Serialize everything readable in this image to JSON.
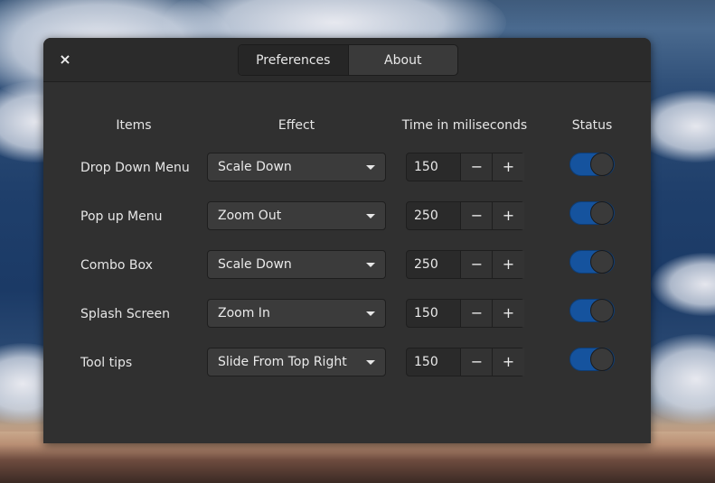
{
  "tabs": [
    {
      "label": "Preferences",
      "active": true
    },
    {
      "label": "About",
      "active": false
    }
  ],
  "close_glyph": "×",
  "columns": {
    "items": "Items",
    "effect": "Effect",
    "time": "Time in miliseconds",
    "status": "Status"
  },
  "rows": [
    {
      "label": "Drop Down Menu",
      "effect": "Scale Down",
      "time": "150",
      "status_on": true
    },
    {
      "label": "Pop up Menu",
      "effect": "Zoom Out",
      "time": "250",
      "status_on": true
    },
    {
      "label": "Combo Box",
      "effect": "Scale Down",
      "time": "250",
      "status_on": true
    },
    {
      "label": "Splash Screen",
      "effect": "Zoom In",
      "time": "150",
      "status_on": true
    },
    {
      "label": "Tool tips",
      "effect": "Slide From Top Right",
      "time": "150",
      "status_on": true
    }
  ],
  "spin_labels": {
    "minus": "−",
    "plus": "+"
  },
  "colors": {
    "accent": "#15539e",
    "window_bg": "#303030",
    "header_bg": "#2b2b2b"
  }
}
